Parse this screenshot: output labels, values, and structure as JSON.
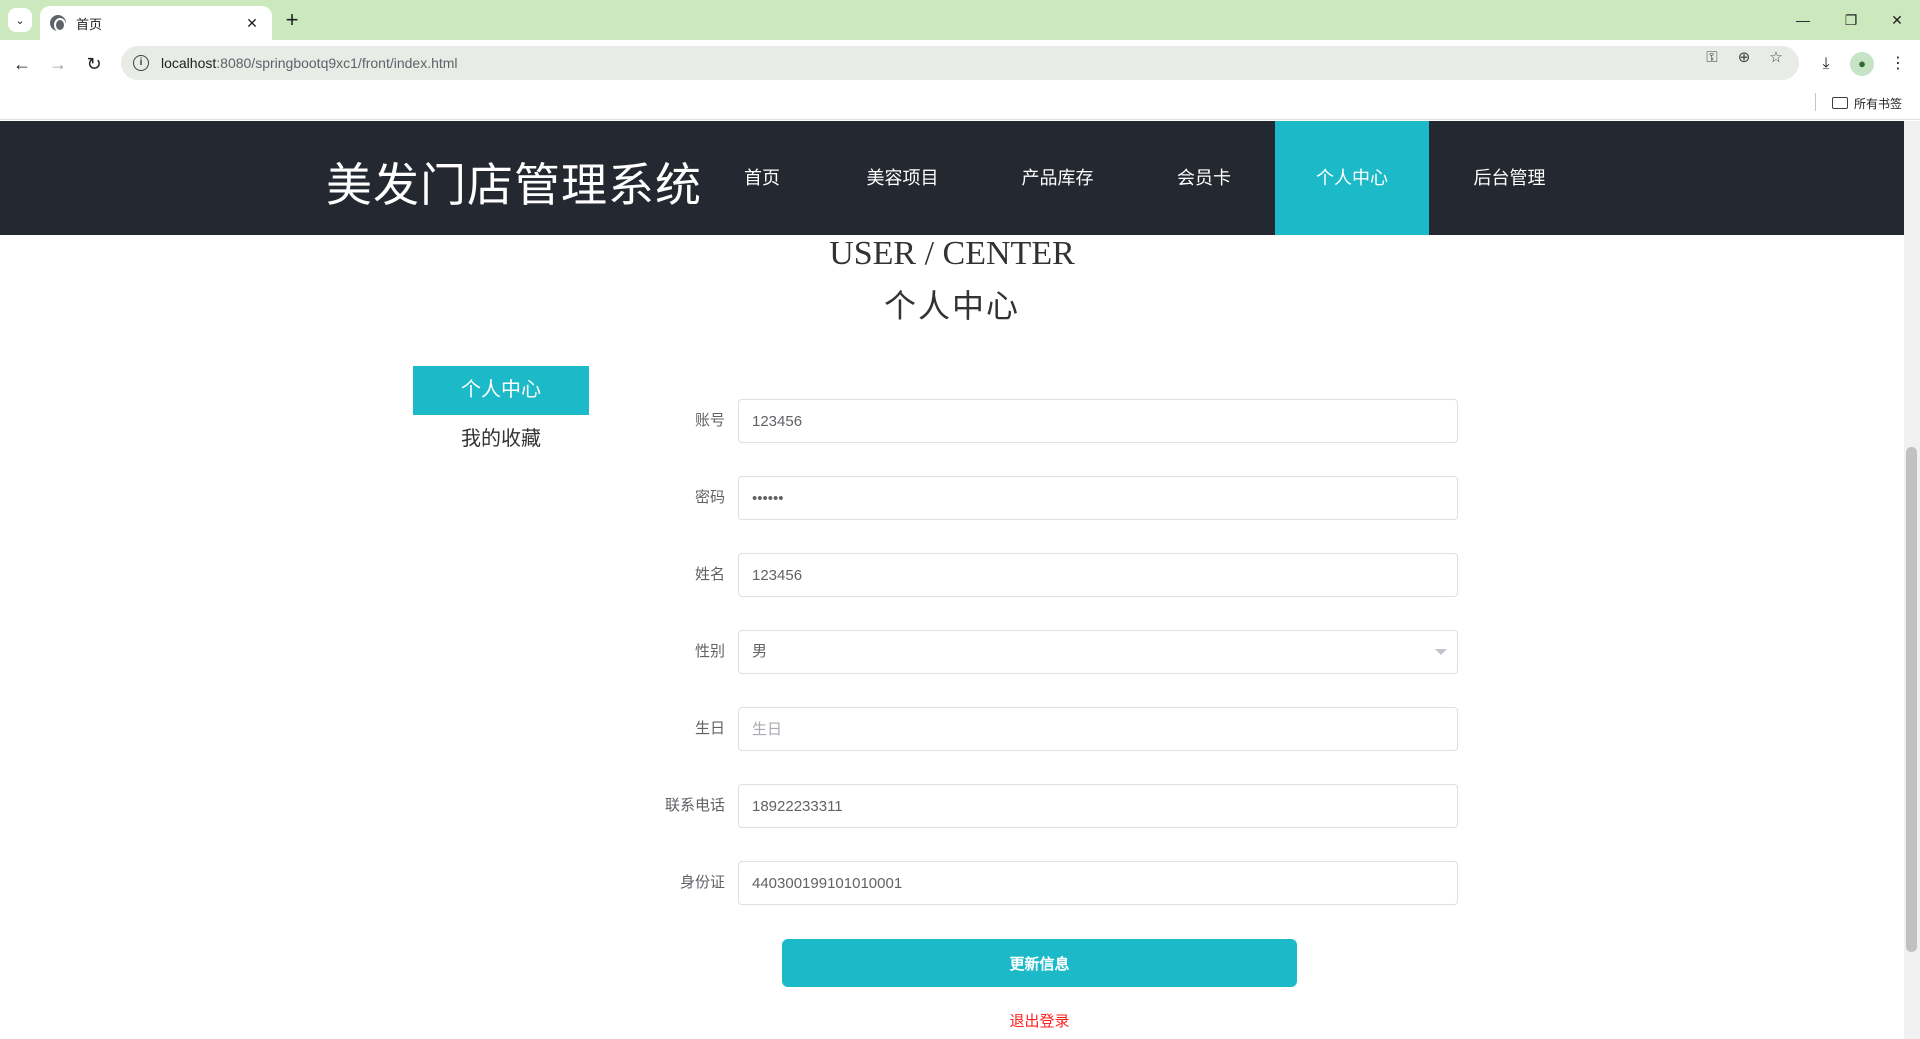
{
  "browser": {
    "tab_title": "首页",
    "url_host": "localhost",
    "url_path": ":8080/springbootq9xc1/front/index.html",
    "bookmarks_all": "所有书签"
  },
  "site": {
    "title": "美发门店管理系统",
    "nav": [
      {
        "label": "首页",
        "active": false
      },
      {
        "label": "美容项目",
        "active": false
      },
      {
        "label": "产品库存",
        "active": false
      },
      {
        "label": "会员卡",
        "active": false
      },
      {
        "label": "个人中心",
        "active": true
      },
      {
        "label": "后台管理",
        "active": false
      }
    ],
    "accent_color": "#1cbac8",
    "header_color": "#232831"
  },
  "section": {
    "title_en": "USER / CENTER",
    "title_cn": "个人中心"
  },
  "sidebar": {
    "items": [
      {
        "label": "个人中心",
        "active": true
      },
      {
        "label": "我的收藏",
        "active": false
      }
    ]
  },
  "form": {
    "account": {
      "label": "账号",
      "value": "123456"
    },
    "password": {
      "label": "密码",
      "value": "••••••"
    },
    "name": {
      "label": "姓名",
      "value": "123456"
    },
    "gender": {
      "label": "性别",
      "value": "男"
    },
    "birthday": {
      "label": "生日",
      "value": "",
      "placeholder": "生日"
    },
    "phone": {
      "label": "联系电话",
      "value": "18922233311"
    },
    "idcard": {
      "label": "身份证",
      "value": "440300199101010001"
    },
    "update_label": "更新信息",
    "logout_label": "退出登录"
  }
}
